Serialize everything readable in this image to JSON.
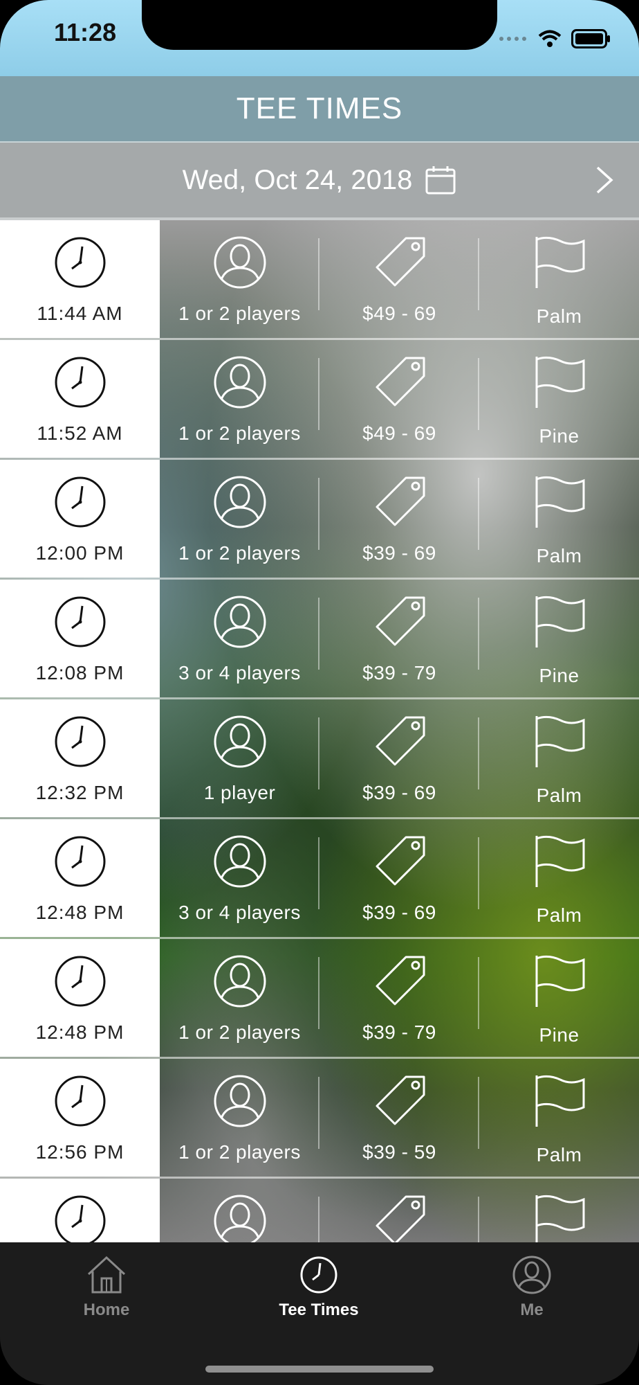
{
  "status_bar": {
    "time": "11:28"
  },
  "header": {
    "title": "TEE TIMES"
  },
  "date_bar": {
    "date": "Wed, Oct 24, 2018"
  },
  "tee_times": [
    {
      "time": "11:44 AM",
      "players": "1 or 2 players",
      "price": "$49 - 69",
      "course": "Palm"
    },
    {
      "time": "11:52 AM",
      "players": "1 or 2 players",
      "price": "$49 - 69",
      "course": "Pine"
    },
    {
      "time": "12:00 PM",
      "players": "1 or 2 players",
      "price": "$39 - 69",
      "course": "Palm"
    },
    {
      "time": "12:08 PM",
      "players": "3 or 4 players",
      "price": "$39 - 79",
      "course": "Pine"
    },
    {
      "time": "12:32 PM",
      "players": "1 player",
      "price": "$39 - 69",
      "course": "Palm"
    },
    {
      "time": "12:48 PM",
      "players": "3 or 4 players",
      "price": "$39 - 69",
      "course": "Palm"
    },
    {
      "time": "12:48 PM",
      "players": "1 or 2 players",
      "price": "$39 - 79",
      "course": "Pine"
    },
    {
      "time": "12:56 PM",
      "players": "1 or 2 players",
      "price": "$39 - 59",
      "course": "Palm"
    },
    {
      "time": "",
      "players": "",
      "price": "",
      "course": ""
    }
  ],
  "tab_bar": {
    "tabs": [
      {
        "label": "Home",
        "icon": "home-icon",
        "active": false
      },
      {
        "label": "Tee Times",
        "icon": "clock-icon",
        "active": true
      },
      {
        "label": "Me",
        "icon": "person-icon",
        "active": false
      }
    ]
  },
  "colors": {
    "status_bar": "#a8dff6",
    "header": "#7f9ea8",
    "date_bar": "#a5a9aa",
    "tab_bar": "#1c1c1c",
    "tab_active": "#ffffff",
    "tab_inactive": "#8a8a8a"
  }
}
